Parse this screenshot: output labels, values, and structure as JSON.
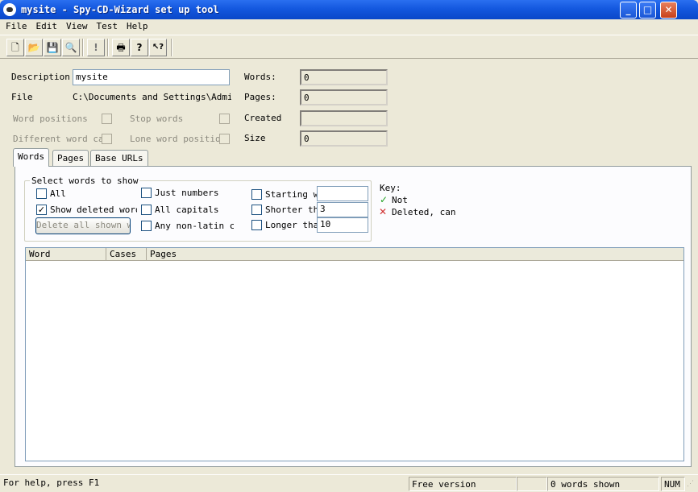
{
  "window": {
    "title": "mysite - Spy-CD-Wizard set up tool"
  },
  "menu": [
    "File",
    "Edit",
    "View",
    "Test",
    "Help"
  ],
  "toolbar": {
    "buttons": [
      {
        "icon": "new-document-icon",
        "glyph": "🗋"
      },
      {
        "icon": "open-folder-icon",
        "glyph": "📂"
      },
      {
        "icon": "save-disk-icon",
        "glyph": "💾"
      },
      {
        "icon": "magnifier-icon",
        "glyph": "🔍"
      },
      {
        "icon": "exclamation-icon",
        "glyph": "!"
      },
      {
        "icon": "printer-icon",
        "glyph": "🖶"
      },
      {
        "icon": "help-icon",
        "glyph": "?"
      },
      {
        "icon": "context-help-icon",
        "glyph": "↖?"
      }
    ]
  },
  "form": {
    "description_label": "Description",
    "description_value": "mysite",
    "file_label": "File",
    "file_value": "C:\\Documents and Settings\\Administrator",
    "word_positions_label": "Word positions",
    "stop_words_label": "Stop words",
    "different_word_case_label": "Different word case",
    "lone_word_positions_label": "Lone word positions",
    "words_label": "Words:",
    "words_value": "0",
    "pages_label": "Pages:",
    "pages_value": "0",
    "created_label": "Created",
    "created_value": "",
    "size_label": "Size",
    "size_value": "0"
  },
  "tabs": [
    "Words",
    "Pages",
    "Base URLs"
  ],
  "select_group": {
    "title": "Select words to show",
    "all": "All",
    "show_deleted": "Show deleted words",
    "delete_button": "Delete all shown words",
    "just_numbers": "Just numbers",
    "all_capitals": "All capitals",
    "any_non_latin": "Any non-latin chars",
    "starting_with": "Starting with",
    "starting_with_value": "",
    "shorter_than": "Shorter than",
    "shorter_than_value": "3",
    "longer_than": "Longer than",
    "longer_than_value": "10"
  },
  "key": {
    "title": "Key:",
    "not_label": "Not",
    "deleted_label": "Deleted, can"
  },
  "columns": [
    "Word",
    "Cases",
    "Pages"
  ],
  "status": {
    "help": "For help, press F1",
    "version": "Free version",
    "words_shown": "0 words shown",
    "num": "NUM"
  },
  "colors": {
    "title_bar": "#0a47c8",
    "face": "#ece9d8",
    "check_mark": "#21a121",
    "delete_mark": "#d03030"
  }
}
